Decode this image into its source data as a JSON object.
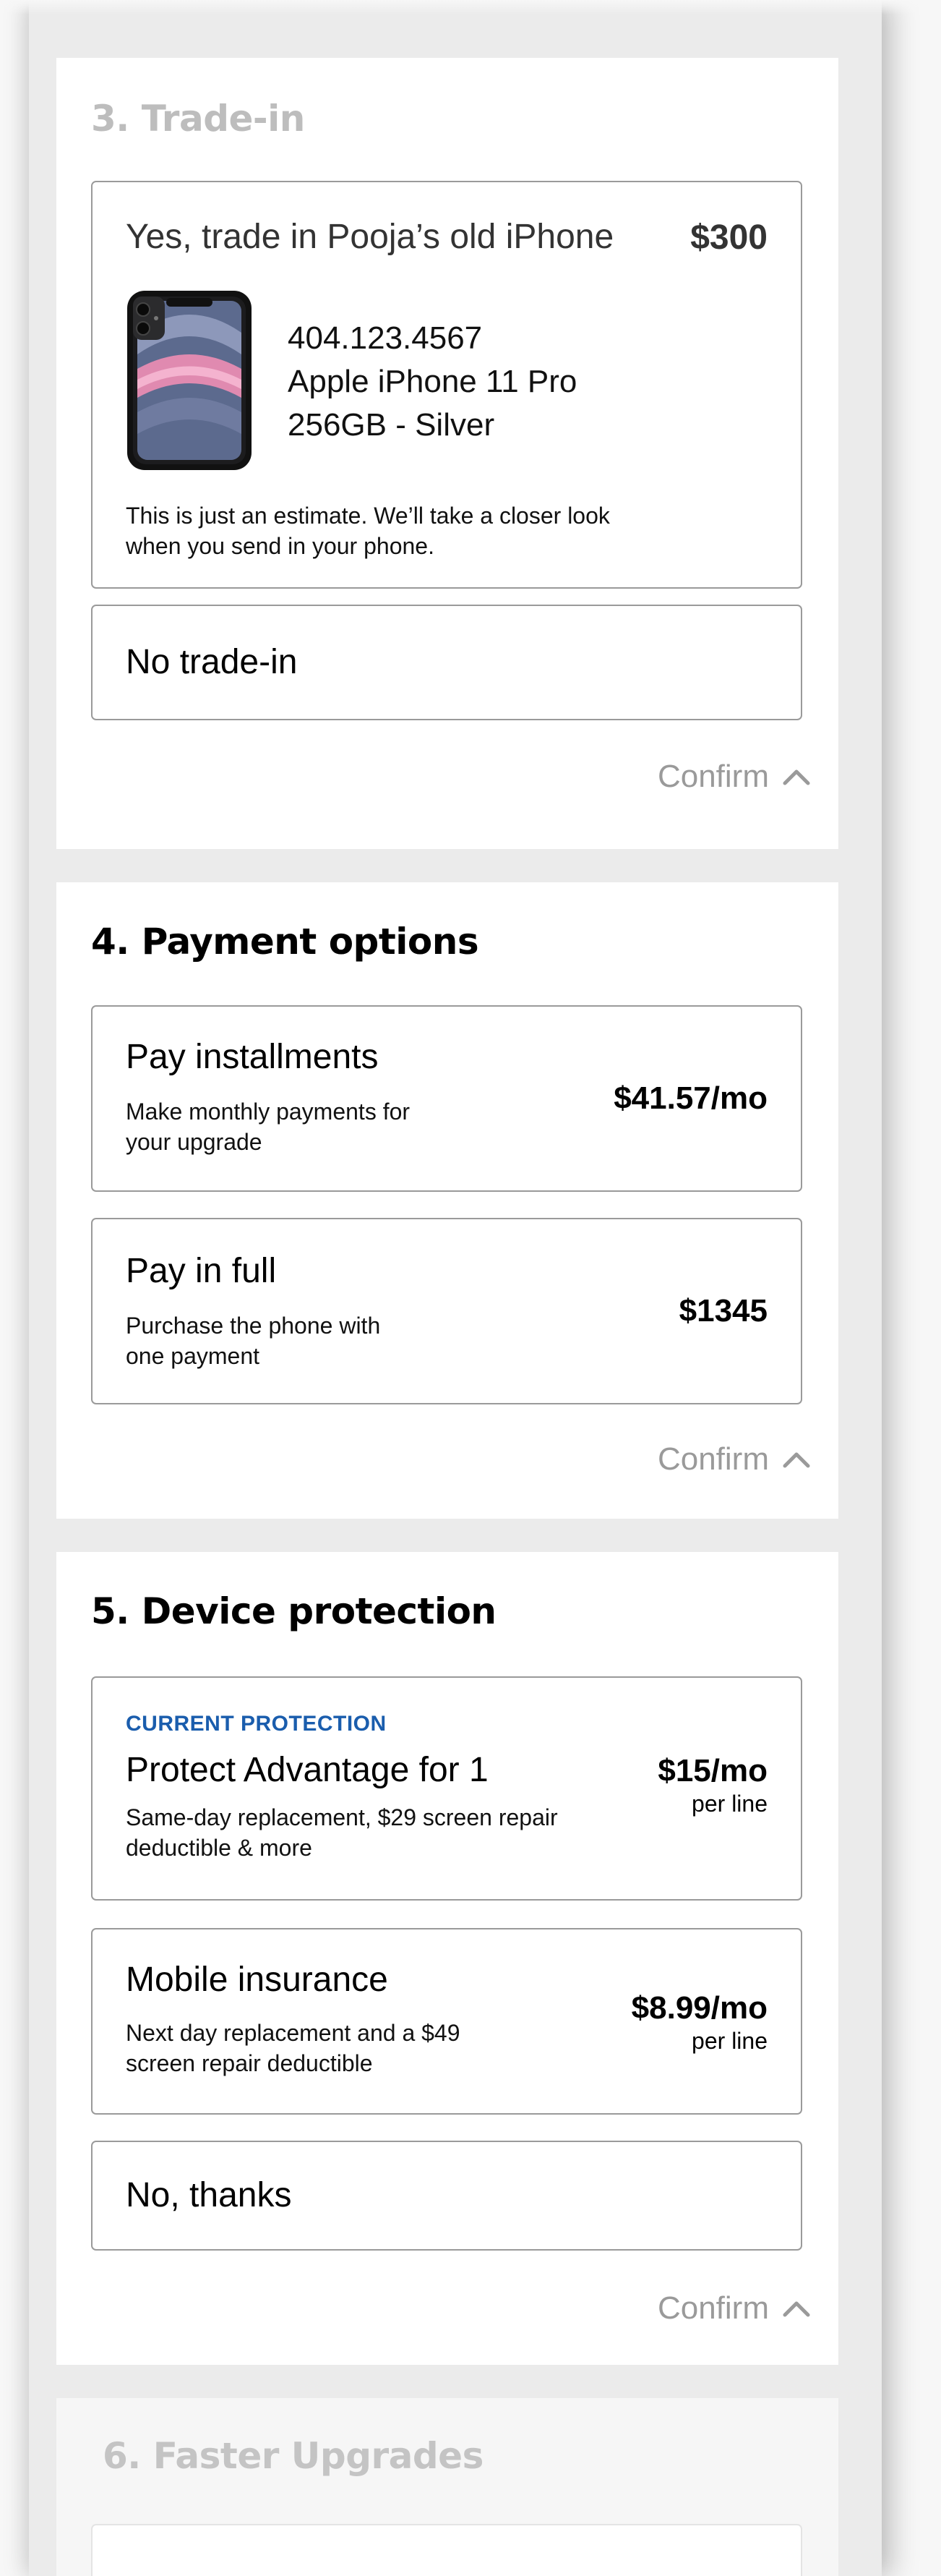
{
  "trade_in": {
    "title": "3. Trade-in",
    "yes_option": {
      "title": "Yes, trade in Pooja’s old iPhone",
      "price": "$300",
      "phone_number": "404.123.4567",
      "model": "Apple iPhone 11 Pro",
      "spec": "256GB - Silver",
      "note": "This is just an estimate. We’ll take a closer look when you send in your phone."
    },
    "no_option": {
      "title": "No trade-in"
    },
    "confirm_label": "Confirm"
  },
  "payment_options": {
    "title": "4. Payment options",
    "installments": {
      "title": "Pay installments",
      "description": "Make monthly payments for your upgrade",
      "price": "$41.57/mo"
    },
    "full": {
      "title": "Pay in full",
      "description": "Purchase the phone with one payment",
      "price": "$1345"
    },
    "confirm_label": "Confirm"
  },
  "device_protection": {
    "title": "5. Device protection",
    "protect_advantage": {
      "eyebrow": "CURRENT PROTECTION",
      "title": "Protect Advantage for 1",
      "description": "Same-day replacement, $29 screen repair deductible & more",
      "price": "$15/mo",
      "price_sub": "per line"
    },
    "mobile_insurance": {
      "title": "Mobile insurance",
      "description": "Next day replacement and a $49 screen repair deductible",
      "price": "$8.99/mo",
      "price_sub": "per line"
    },
    "no_thanks": {
      "title": "No, thanks"
    },
    "confirm_label": "Confirm"
  },
  "faster_upgrades": {
    "title": "6. Faster Upgrades"
  },
  "colors": {
    "accent_blue": "#1a5dad",
    "border": "#9a9a9a",
    "muted": "#9a9a9a",
    "page_bg": "#ebebeb"
  },
  "icons": {
    "confirm": "chevron-up-icon",
    "device": "iphone-image"
  }
}
